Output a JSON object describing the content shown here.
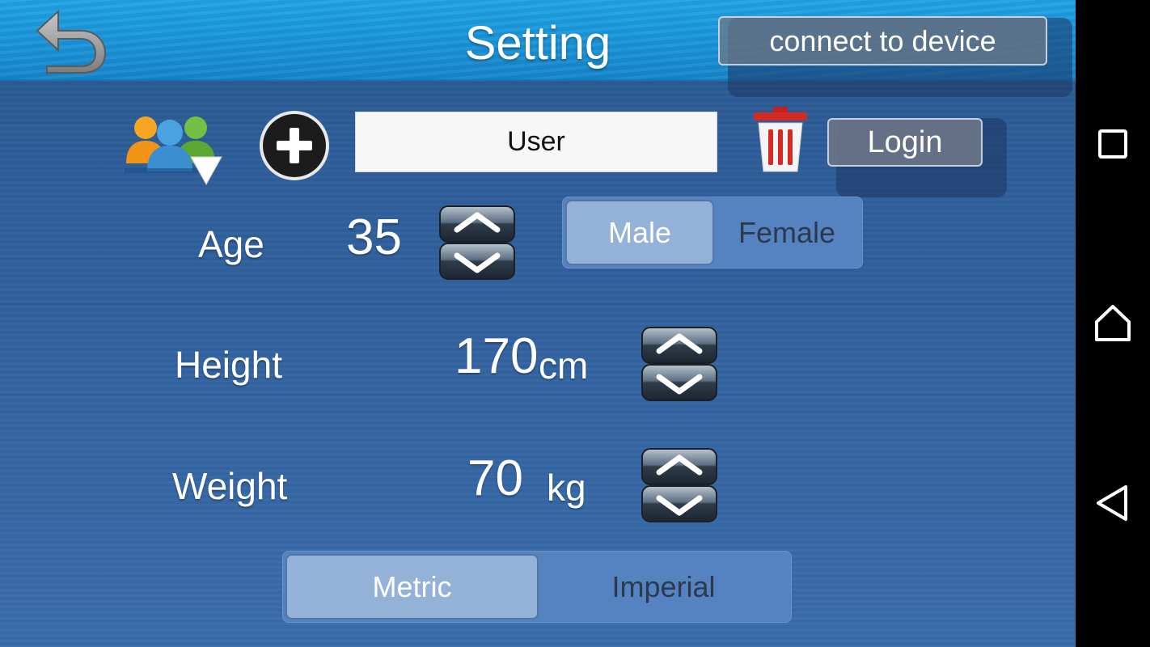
{
  "header": {
    "title": "Setting",
    "connect_label": "connect to device",
    "back_icon": "back-arrow-icon"
  },
  "user_row": {
    "users_icon": "users-dropdown-icon",
    "add_icon": "plus-circle-icon",
    "user_value": "User",
    "delete_icon": "trash-icon",
    "login_label": "Login"
  },
  "age": {
    "label": "Age",
    "value": "35"
  },
  "gender": {
    "options": [
      "Male",
      "Female"
    ],
    "selected": "Male"
  },
  "height": {
    "label": "Height",
    "value": "170",
    "unit": "cm"
  },
  "weight": {
    "label": "Weight",
    "value": "70",
    "unit": "kg"
  },
  "units": {
    "options": [
      "Metric",
      "Imperial"
    ],
    "selected": "Metric"
  },
  "navbar": {
    "icons": [
      "recents-square-icon",
      "home-icon",
      "back-triangle-icon"
    ]
  },
  "colors": {
    "header": "#1893d8",
    "background": "#2f5f9b",
    "segment_active": "#94b2d8",
    "segment_inactive": "#5582c0"
  }
}
